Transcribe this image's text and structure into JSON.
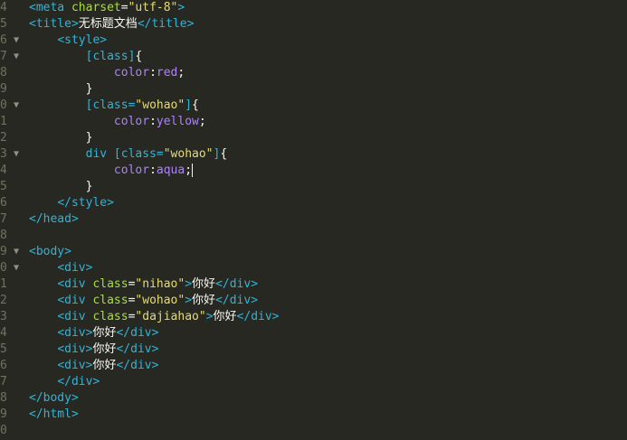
{
  "editor": {
    "lines": [
      {
        "num": "4",
        "fold": "",
        "indent": "",
        "segments": [
          {
            "t": "<meta ",
            "c": "tag"
          },
          {
            "t": "charset",
            "c": "attr"
          },
          {
            "t": "=",
            "c": "txt"
          },
          {
            "t": "\"utf-8\"",
            "c": "str"
          },
          {
            "t": ">",
            "c": "tag"
          }
        ]
      },
      {
        "num": "5",
        "fold": "",
        "indent": "",
        "segments": [
          {
            "t": "<title>",
            "c": "tag"
          },
          {
            "t": "无标题文档",
            "c": "txt"
          },
          {
            "t": "</title>",
            "c": "tag"
          }
        ]
      },
      {
        "num": "6",
        "fold": "▼",
        "indent": "    ",
        "segments": [
          {
            "t": "<style>",
            "c": "tag"
          }
        ]
      },
      {
        "num": "7",
        "fold": "▼",
        "indent": "        ",
        "segments": [
          {
            "t": "[class]",
            "c": "sel"
          },
          {
            "t": "{",
            "c": "txt"
          }
        ]
      },
      {
        "num": "8",
        "fold": "",
        "indent": "            ",
        "segments": [
          {
            "t": "color",
            "c": "prop"
          },
          {
            "t": ":",
            "c": "txt"
          },
          {
            "t": "red",
            "c": "val"
          },
          {
            "t": ";",
            "c": "txt"
          }
        ]
      },
      {
        "num": "9",
        "fold": "",
        "indent": "        ",
        "segments": [
          {
            "t": "}",
            "c": "txt"
          }
        ]
      },
      {
        "num": "0",
        "fold": "▼",
        "indent": "        ",
        "segments": [
          {
            "t": "[class=",
            "c": "sel"
          },
          {
            "t": "\"wohao\"",
            "c": "str"
          },
          {
            "t": "]",
            "c": "sel"
          },
          {
            "t": "{",
            "c": "txt"
          }
        ]
      },
      {
        "num": "1",
        "fold": "",
        "indent": "            ",
        "segments": [
          {
            "t": "color",
            "c": "prop"
          },
          {
            "t": ":",
            "c": "txt"
          },
          {
            "t": "yellow",
            "c": "val"
          },
          {
            "t": ";",
            "c": "txt"
          }
        ]
      },
      {
        "num": "2",
        "fold": "",
        "indent": "        ",
        "segments": [
          {
            "t": "}",
            "c": "txt"
          }
        ]
      },
      {
        "num": "3",
        "fold": "▼",
        "indent": "        ",
        "segments": [
          {
            "t": "div [class=",
            "c": "sel"
          },
          {
            "t": "\"wohao\"",
            "c": "str"
          },
          {
            "t": "]",
            "c": "sel"
          },
          {
            "t": "{",
            "c": "txt"
          }
        ]
      },
      {
        "num": "4",
        "fold": "",
        "indent": "            ",
        "segments": [
          {
            "t": "color",
            "c": "prop"
          },
          {
            "t": ":",
            "c": "txt"
          },
          {
            "t": "aqua",
            "c": "val"
          },
          {
            "t": ";",
            "c": "txt"
          },
          {
            "t": "",
            "c": "cursor"
          }
        ]
      },
      {
        "num": "5",
        "fold": "",
        "indent": "        ",
        "segments": [
          {
            "t": "}",
            "c": "txt"
          }
        ]
      },
      {
        "num": "6",
        "fold": "",
        "indent": "    ",
        "segments": [
          {
            "t": "</style>",
            "c": "tag"
          }
        ]
      },
      {
        "num": "7",
        "fold": "",
        "indent": "",
        "segments": [
          {
            "t": "</head>",
            "c": "tag"
          }
        ]
      },
      {
        "num": "8",
        "fold": "",
        "indent": "",
        "segments": []
      },
      {
        "num": "9",
        "fold": "▼",
        "indent": "",
        "segments": [
          {
            "t": "<body>",
            "c": "tag"
          }
        ]
      },
      {
        "num": "0",
        "fold": "▼",
        "indent": "    ",
        "segments": [
          {
            "t": "<div>",
            "c": "tag"
          }
        ]
      },
      {
        "num": "1",
        "fold": "",
        "indent": "    ",
        "segments": [
          {
            "t": "<div ",
            "c": "tag"
          },
          {
            "t": "class",
            "c": "attr"
          },
          {
            "t": "=",
            "c": "txt"
          },
          {
            "t": "\"nihao\"",
            "c": "str"
          },
          {
            "t": ">",
            "c": "tag"
          },
          {
            "t": "你好",
            "c": "txt"
          },
          {
            "t": "</div>",
            "c": "tag"
          }
        ]
      },
      {
        "num": "2",
        "fold": "",
        "indent": "    ",
        "segments": [
          {
            "t": "<div ",
            "c": "tag"
          },
          {
            "t": "class",
            "c": "attr"
          },
          {
            "t": "=",
            "c": "txt"
          },
          {
            "t": "\"wohao\"",
            "c": "str"
          },
          {
            "t": ">",
            "c": "tag"
          },
          {
            "t": "你好",
            "c": "txt"
          },
          {
            "t": "</div>",
            "c": "tag"
          }
        ]
      },
      {
        "num": "3",
        "fold": "",
        "indent": "    ",
        "segments": [
          {
            "t": "<div ",
            "c": "tag"
          },
          {
            "t": "class",
            "c": "attr"
          },
          {
            "t": "=",
            "c": "txt"
          },
          {
            "t": "\"dajiahao\"",
            "c": "str"
          },
          {
            "t": ">",
            "c": "tag"
          },
          {
            "t": "你好",
            "c": "txt"
          },
          {
            "t": "</div>",
            "c": "tag"
          }
        ]
      },
      {
        "num": "4",
        "fold": "",
        "indent": "    ",
        "segments": [
          {
            "t": "<div>",
            "c": "tag"
          },
          {
            "t": "你好",
            "c": "txt"
          },
          {
            "t": "</div>",
            "c": "tag"
          }
        ]
      },
      {
        "num": "5",
        "fold": "",
        "indent": "    ",
        "segments": [
          {
            "t": "<div>",
            "c": "tag"
          },
          {
            "t": "你好",
            "c": "txt"
          },
          {
            "t": "</div>",
            "c": "tag"
          }
        ]
      },
      {
        "num": "6",
        "fold": "",
        "indent": "    ",
        "segments": [
          {
            "t": "<div>",
            "c": "tag"
          },
          {
            "t": "你好",
            "c": "txt"
          },
          {
            "t": "</div>",
            "c": "tag"
          }
        ]
      },
      {
        "num": "7",
        "fold": "",
        "indent": "    ",
        "segments": [
          {
            "t": "</div>",
            "c": "tag"
          }
        ]
      },
      {
        "num": "8",
        "fold": "",
        "indent": "",
        "segments": [
          {
            "t": "</body>",
            "c": "tag"
          }
        ]
      },
      {
        "num": "9",
        "fold": "",
        "indent": "",
        "segments": [
          {
            "t": "</html>",
            "c": "tag"
          }
        ]
      },
      {
        "num": "0",
        "fold": "",
        "indent": "",
        "segments": []
      }
    ]
  }
}
